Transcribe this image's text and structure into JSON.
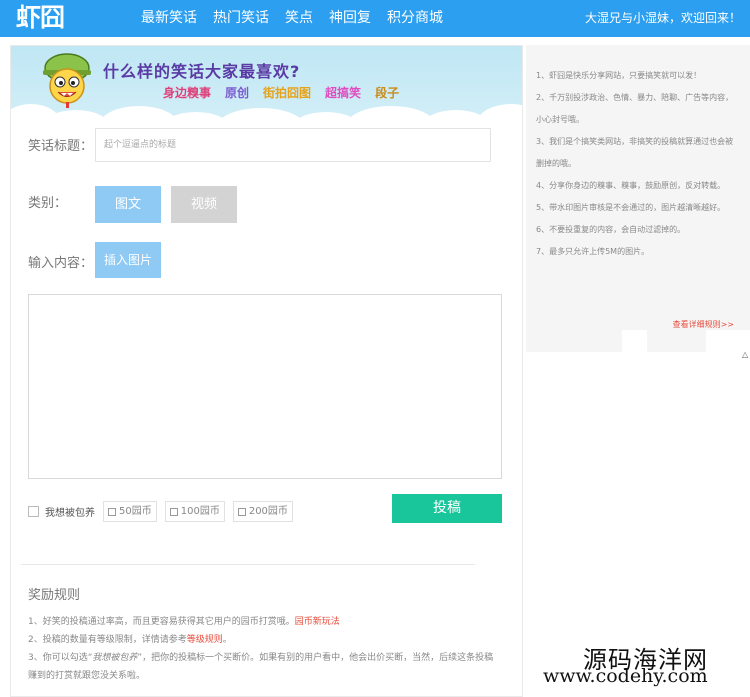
{
  "header": {
    "logo": "虾囧",
    "nav": [
      "最新笑话",
      "热门笑话",
      "笑点",
      "神回复",
      "积分商城"
    ],
    "welcome": "大湿兄与小湿妹，欢迎回来！"
  },
  "banner": {
    "title": "什么样的笑话大家最喜欢?",
    "tags": [
      {
        "label": "身边糗事",
        "color": "#e0407a"
      },
      {
        "label": "原创",
        "color": "#7a5bd0"
      },
      {
        "label": "街拍囧图",
        "color": "#e6a21a"
      },
      {
        "label": "超搞笑",
        "color": "#e04dc0"
      },
      {
        "label": "段子",
        "color": "#c98b19"
      }
    ]
  },
  "form": {
    "title_label": "笑话标题：",
    "title_placeholder": "起个逗逼点的标题",
    "type_label": "类别：",
    "type_options": [
      "图文",
      "视频"
    ],
    "content_label": "输入内容：",
    "insert_image": "插入图片",
    "buyout_label": "我想被包养",
    "coin_options": [
      "50园币",
      "100园币",
      "200园币"
    ],
    "submit": "投稿"
  },
  "rules": {
    "title": "奖励规则",
    "item1_text": "1、好笑的投稿通过率高，而且更容易获得其它用户的园币打赏哦。",
    "item1_link": "园币新玩法",
    "item2_text": "2、投稿的数量有等级限制，详情请参考",
    "item2_link": "等级规则",
    "item2_end": "。",
    "item3_a": "3、你可以勾选“",
    "item3_em": "我想被包养",
    "item3_b": "”，把你的投稿标一个买断价。如果有别的用户看中，他会出价买断，当然，后续这条投稿赚到的打赏就跟您没关系啦。"
  },
  "sidebar": {
    "tips": [
      "1、虾囧是快乐分享网站，只要搞笑就可以发！",
      "2、千万别投涉政治、色情、暴力、陪聊、广告等内容，小心封号哦。",
      "3、我们是个搞笑类网站，非搞笑的投稿就算通过也会被删掉的哦。",
      "4、分享你身边的糗事、糗事，鼓励原创，反对转载。",
      "5、带水印图片审核是不会通过的，图片越清晰越好。",
      "6、不要投重复的内容，会自动过滤掉的。",
      "7、最多只允许上传5M的图片。"
    ],
    "more_link": "查看详细规则>>",
    "arrow": "△"
  },
  "watermark": {
    "line1": "源码海洋网",
    "line2": "www.codehy.com"
  },
  "colors": {
    "brand_blue": "#2d9ff0",
    "active_type": "#8ecaf4",
    "inactive_type": "#d3d3d3",
    "submit_green": "#19c59a",
    "link_red": "#e74c3c"
  }
}
